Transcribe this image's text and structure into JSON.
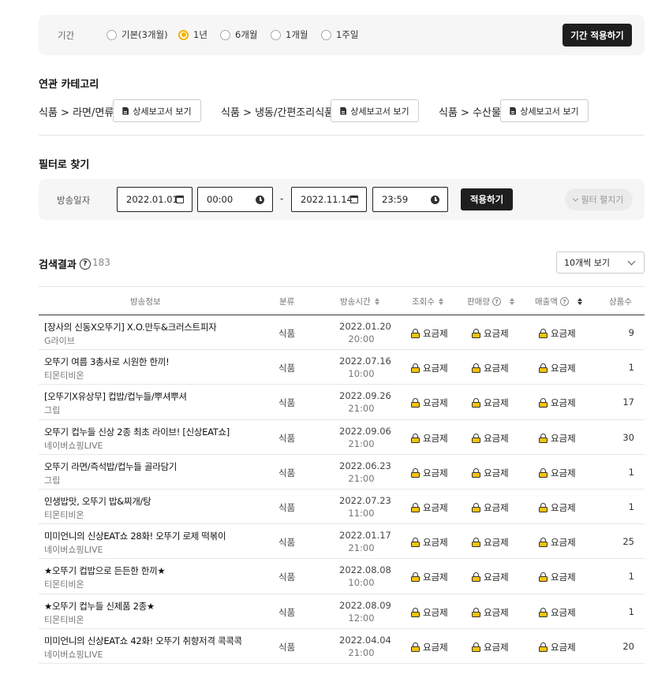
{
  "period": {
    "label": "기간",
    "options": [
      "기본(3개월)",
      "1년",
      "6개월",
      "1개월",
      "1주일"
    ],
    "selected": "1년",
    "apply_label": "기간 적용하기"
  },
  "related": {
    "title": "연관 카테고리",
    "categories": [
      {
        "name": "식품 > 라면/면류",
        "button": "상세보고서 보기"
      },
      {
        "name": "식품 > 냉동/간편조리식품",
        "button": "상세보고서 보기"
      },
      {
        "name": "식품 > 수산물",
        "button": "상세보고서 보기"
      }
    ]
  },
  "filter": {
    "title": "필터로 찾기",
    "label": "방송일자",
    "start_date": "2022.01.01",
    "start_time": "00:00",
    "separator": "-",
    "end_date": "2022.11.14",
    "end_time": "23:59",
    "apply_label": "적용하기",
    "expand_label": "필터 펼치기"
  },
  "results": {
    "title": "검색결과",
    "count": "183",
    "per_page": "10개씩 보기",
    "columns": [
      "방송정보",
      "분류",
      "방송시간",
      "조회수",
      "판매량",
      "매출액",
      "상품수"
    ],
    "rows": [
      {
        "title": "[장사의 신동X오뚜기] X.O.만두&크러스트피자",
        "channel": "G라이브",
        "category": "식품",
        "date": "2022.01.20",
        "time": "20:00",
        "views": "요금제",
        "sales": "요금제",
        "revenue": "요금제",
        "products": "9"
      },
      {
        "title": "오뚜기 여름 3총사로 시원한 한끼!",
        "channel": "티몬티비온",
        "category": "식품",
        "date": "2022.07.16",
        "time": "10:00",
        "views": "요금제",
        "sales": "요금제",
        "revenue": "요금제",
        "products": "1"
      },
      {
        "title": "[오뚜기X유상무] 컵밥/컵누들/뿌셔뿌셔",
        "channel": "그립",
        "category": "식품",
        "date": "2022.09.26",
        "time": "21:00",
        "views": "요금제",
        "sales": "요금제",
        "revenue": "요금제",
        "products": "17"
      },
      {
        "title": "오뚜기 컵누들 신상 2종 최초 라이브! [신상EAT쇼]",
        "channel": "네이버쇼핑LIVE",
        "category": "식품",
        "date": "2022.09.06",
        "time": "21:00",
        "views": "요금제",
        "sales": "요금제",
        "revenue": "요금제",
        "products": "30"
      },
      {
        "title": "오뚜기 라면/즉석밥/컵누들 골라담기",
        "channel": "그립",
        "category": "식품",
        "date": "2022.06.23",
        "time": "21:00",
        "views": "요금제",
        "sales": "요금제",
        "revenue": "요금제",
        "products": "1"
      },
      {
        "title": "인생밥맛, 오뚜기 밥&찌개/탕",
        "channel": "티몬티비온",
        "category": "식품",
        "date": "2022.07.23",
        "time": "11:00",
        "views": "요금제",
        "sales": "요금제",
        "revenue": "요금제",
        "products": "1"
      },
      {
        "title": "미미언니의 신상EAT쇼 28화! 오뚜기 로제 떡볶이",
        "channel": "네이버쇼핑LIVE",
        "category": "식품",
        "date": "2022.01.17",
        "time": "21:00",
        "views": "요금제",
        "sales": "요금제",
        "revenue": "요금제",
        "products": "25"
      },
      {
        "title": "★오뚜기 컵밥으로 든든한 한끼★",
        "channel": "티몬티비온",
        "category": "식품",
        "date": "2022.08.08",
        "time": "10:00",
        "views": "요금제",
        "sales": "요금제",
        "revenue": "요금제",
        "products": "1"
      },
      {
        "title": "★오뚜기 컵누들 신제품 2종★",
        "channel": "티몬티비온",
        "category": "식품",
        "date": "2022.08.09",
        "time": "12:00",
        "views": "요금제",
        "sales": "요금제",
        "revenue": "요금제",
        "products": "1"
      },
      {
        "title": "미미언니의 신상EAT쇼 42화! 오뚜기 취향저격 콕콕콕",
        "channel": "네이버쇼핑LIVE",
        "category": "식품",
        "date": "2022.04.04",
        "time": "21:00",
        "views": "요금제",
        "sales": "요금제",
        "revenue": "요금제",
        "products": "20"
      }
    ]
  },
  "colors": {
    "accent": "#f4b400",
    "dark_button": "#1e1e1e",
    "panel_bg": "#f6f6f6"
  }
}
